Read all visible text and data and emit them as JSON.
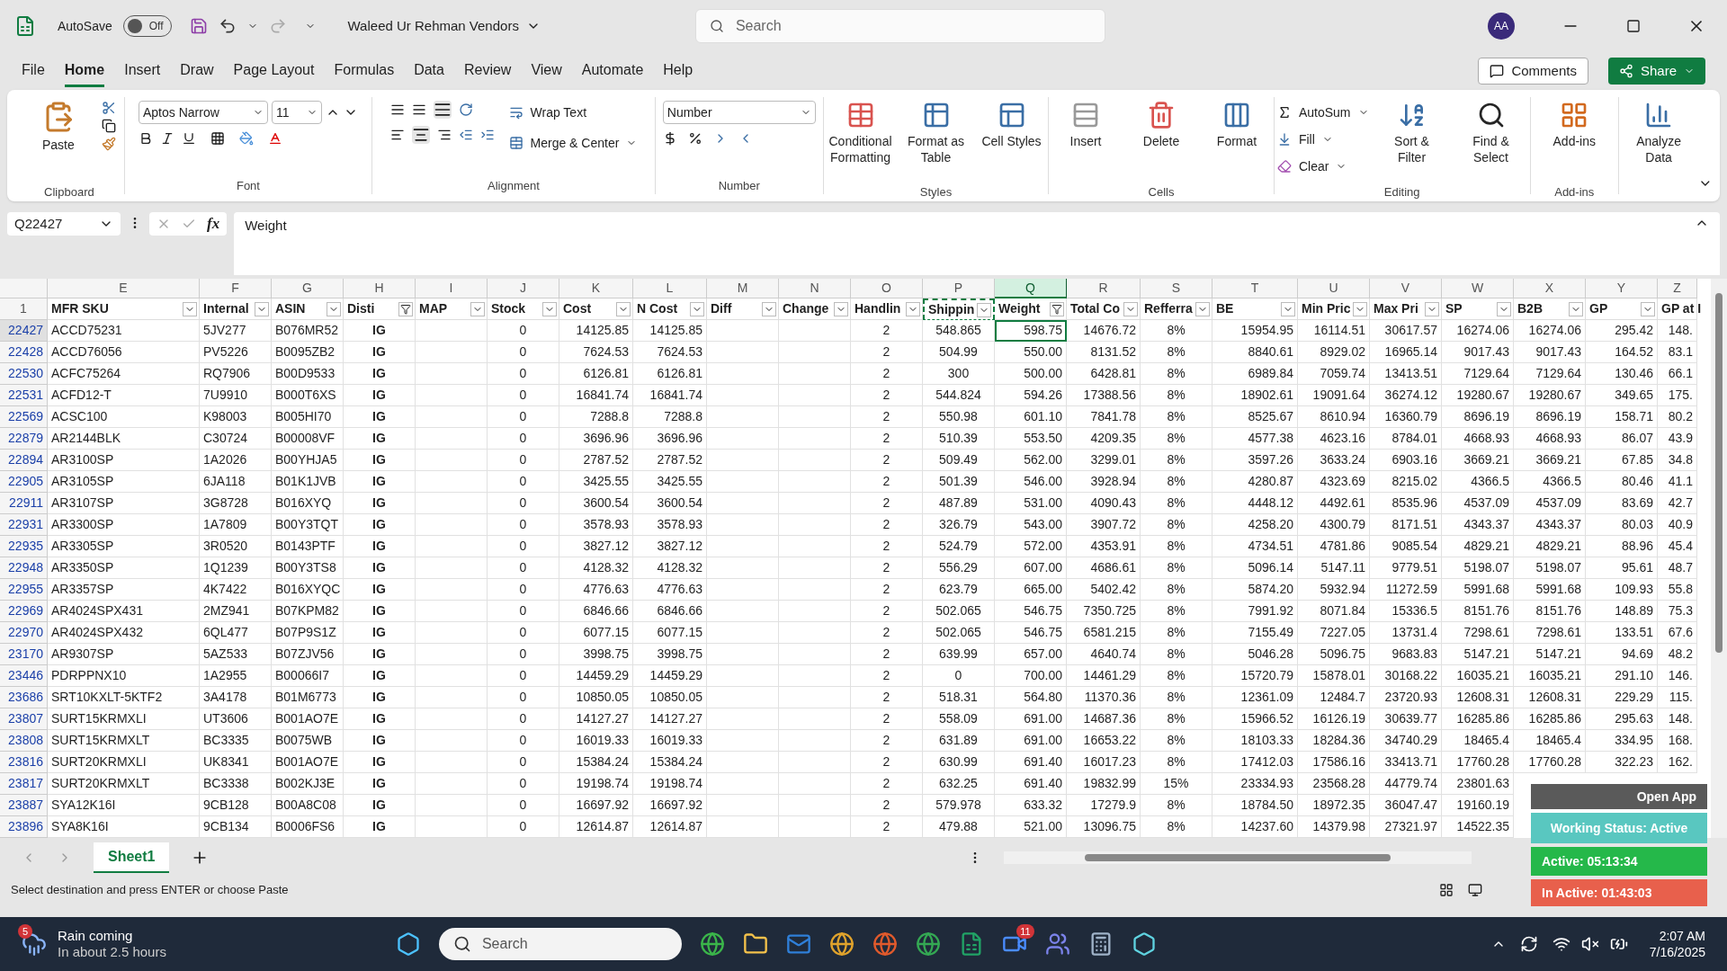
{
  "title_bar": {
    "autosave_label": "AutoSave",
    "autosave_state": "Off",
    "autosave_on": false,
    "document": "Waleed Ur Rehman Vendors",
    "search_placeholder": "Search",
    "avatar": "AA"
  },
  "menu_tabs": [
    {
      "label": "File",
      "selected": false
    },
    {
      "label": "Home",
      "selected": true
    },
    {
      "label": "Insert",
      "selected": false
    },
    {
      "label": "Draw",
      "selected": false
    },
    {
      "label": "Page Layout",
      "selected": false
    },
    {
      "label": "Formulas",
      "selected": false
    },
    {
      "label": "Data",
      "selected": false
    },
    {
      "label": "Review",
      "selected": false
    },
    {
      "label": "View",
      "selected": false
    },
    {
      "label": "Automate",
      "selected": false
    },
    {
      "label": "Help",
      "selected": false
    }
  ],
  "actions": {
    "comments": "Comments",
    "share": "Share"
  },
  "ribbon": {
    "paste": "Paste",
    "font_name": "Aptos Narrow",
    "font_size": "11",
    "wrap_text": "Wrap Text",
    "merge_center": "Merge & Center",
    "number_format": "Number",
    "styles": [
      "Conditional Formatting",
      "Format as Table",
      "Cell Styles"
    ],
    "cells": [
      "Insert",
      "Delete",
      "Format"
    ],
    "editing_small": [
      "AutoSum",
      "Fill",
      "Clear"
    ],
    "editing_large": [
      "Sort & Filter",
      "Find & Select"
    ],
    "addins": "Add-ins",
    "analyze": "Analyze Data",
    "group_labels": [
      "Clipboard",
      "Font",
      "Alignment",
      "Number",
      "Styles",
      "Cells",
      "Editing",
      "Add-ins"
    ]
  },
  "formula_bar": {
    "name_box": "Q22427",
    "function_label": "fx",
    "formula": "Weight"
  },
  "sheet": {
    "header_row_number": "1",
    "columns": [
      {
        "letter": "E",
        "header": "MFR SKU",
        "filtered": false,
        "selected": false,
        "copied": false
      },
      {
        "letter": "F",
        "header": "Internal",
        "filtered": false,
        "selected": false,
        "copied": false
      },
      {
        "letter": "G",
        "header": "ASIN",
        "filtered": false,
        "selected": false,
        "copied": false
      },
      {
        "letter": "H",
        "header": "Disti",
        "filtered": true,
        "selected": false,
        "copied": false
      },
      {
        "letter": "I",
        "header": "MAP",
        "filtered": false,
        "selected": false,
        "copied": false
      },
      {
        "letter": "J",
        "header": "Stock",
        "filtered": false,
        "selected": false,
        "copied": false
      },
      {
        "letter": "K",
        "header": "Cost",
        "filtered": false,
        "selected": false,
        "copied": false
      },
      {
        "letter": "L",
        "header": "N Cost",
        "filtered": false,
        "selected": false,
        "copied": false
      },
      {
        "letter": "M",
        "header": "Diff",
        "filtered": false,
        "selected": false,
        "copied": false
      },
      {
        "letter": "N",
        "header": "Change",
        "filtered": false,
        "selected": false,
        "copied": false
      },
      {
        "letter": "O",
        "header": "Handlin",
        "filtered": false,
        "selected": false,
        "copied": false
      },
      {
        "letter": "P",
        "header": "Shippin",
        "filtered": false,
        "selected": false,
        "copied": true
      },
      {
        "letter": "Q",
        "header": "Weight",
        "filtered": true,
        "selected": true,
        "copied": false
      },
      {
        "letter": "R",
        "header": "Total Co",
        "filtered": false,
        "selected": false,
        "copied": false
      },
      {
        "letter": "S",
        "header": "Refferra",
        "filtered": false,
        "selected": false,
        "copied": false
      },
      {
        "letter": "T",
        "header": "BE",
        "filtered": false,
        "selected": false,
        "copied": false
      },
      {
        "letter": "U",
        "header": "Min Pric",
        "filtered": false,
        "selected": false,
        "copied": false
      },
      {
        "letter": "V",
        "header": "Max Pri",
        "filtered": false,
        "selected": false,
        "copied": false
      },
      {
        "letter": "W",
        "header": "SP",
        "filtered": false,
        "selected": false,
        "copied": false
      },
      {
        "letter": "X",
        "header": "B2B",
        "filtered": false,
        "selected": false,
        "copied": false
      },
      {
        "letter": "Y",
        "header": "GP",
        "filtered": false,
        "selected": false,
        "copied": false
      },
      {
        "letter": "Z",
        "header": "GP at I",
        "selected": false,
        "copied": false
      }
    ],
    "rows": [
      {
        "row": "22427",
        "selected": true,
        "cells": [
          "ACCD75231",
          "5JV277",
          "B076MR52",
          "IG",
          null,
          "0",
          "14125.85",
          "14125.85",
          null,
          null,
          "2",
          "548.865",
          "598.75",
          "14676.72",
          "8%",
          "15954.95",
          "16114.51",
          "30617.57",
          "16274.06",
          "16274.06",
          "295.42",
          "148."
        ]
      },
      {
        "row": "22428",
        "selected": false,
        "cells": [
          "ACCD76056",
          "PV5226",
          "B0095ZB2",
          "IG",
          null,
          "0",
          "7624.53",
          "7624.53",
          null,
          null,
          "2",
          "504.99",
          "550.00",
          "8131.52",
          "8%",
          "8840.61",
          "8929.02",
          "16965.14",
          "9017.43",
          "9017.43",
          "164.52",
          "83.1"
        ]
      },
      {
        "row": "22530",
        "selected": false,
        "cells": [
          "ACFC75264",
          "RQ7906",
          "B00D9533",
          "IG",
          null,
          "0",
          "6126.81",
          "6126.81",
          null,
          null,
          "2",
          "300",
          "500.00",
          "6428.81",
          "8%",
          "6989.84",
          "7059.74",
          "13413.51",
          "7129.64",
          "7129.64",
          "130.46",
          "66.1"
        ]
      },
      {
        "row": "22531",
        "selected": false,
        "cells": [
          "ACFD12-T",
          "7U9910",
          "B000T6XS",
          "IG",
          null,
          "0",
          "16841.74",
          "16841.74",
          null,
          null,
          "2",
          "544.824",
          "594.26",
          "17388.56",
          "8%",
          "18902.61",
          "19091.64",
          "36274.12",
          "19280.67",
          "19280.67",
          "349.65",
          "175."
        ]
      },
      {
        "row": "22569",
        "selected": false,
        "cells": [
          "ACSC100",
          "K98003",
          "B005HI70",
          "IG",
          null,
          "0",
          "7288.8",
          "7288.8",
          null,
          null,
          "2",
          "550.98",
          "601.10",
          "7841.78",
          "8%",
          "8525.67",
          "8610.94",
          "16360.79",
          "8696.19",
          "8696.19",
          "158.71",
          "80.2"
        ]
      },
      {
        "row": "22879",
        "selected": false,
        "cells": [
          "AR2144BLK",
          "C30724",
          "B00008VF",
          "IG",
          null,
          "0",
          "3696.96",
          "3696.96",
          null,
          null,
          "2",
          "510.39",
          "553.50",
          "4209.35",
          "8%",
          "4577.38",
          "4623.16",
          "8784.01",
          "4668.93",
          "4668.93",
          "86.07",
          "43.9"
        ]
      },
      {
        "row": "22894",
        "selected": false,
        "cells": [
          "AR3100SP",
          "1A2026",
          "B00YHJA5",
          "IG",
          null,
          "0",
          "2787.52",
          "2787.52",
          null,
          null,
          "2",
          "509.49",
          "562.00",
          "3299.01",
          "8%",
          "3597.26",
          "3633.24",
          "6903.16",
          "3669.21",
          "3669.21",
          "67.85",
          "34.8"
        ]
      },
      {
        "row": "22905",
        "selected": false,
        "cells": [
          "AR3105SP",
          "6JA118",
          "B01K1JVB",
          "IG",
          null,
          "0",
          "3425.55",
          "3425.55",
          null,
          null,
          "2",
          "501.39",
          "546.00",
          "3928.94",
          "8%",
          "4280.87",
          "4323.69",
          "8215.02",
          "4366.5",
          "4366.5",
          "80.46",
          "41.1"
        ]
      },
      {
        "row": "22911",
        "selected": false,
        "cells": [
          "AR3107SP",
          "3G8728",
          "B016XYQ",
          "IG",
          null,
          "0",
          "3600.54",
          "3600.54",
          null,
          null,
          "2",
          "487.89",
          "531.00",
          "4090.43",
          "8%",
          "4448.12",
          "4492.61",
          "8535.96",
          "4537.09",
          "4537.09",
          "83.69",
          "42.7"
        ]
      },
      {
        "row": "22931",
        "selected": false,
        "cells": [
          "AR3300SP",
          "1A7809",
          "B00Y3TQT",
          "IG",
          null,
          "0",
          "3578.93",
          "3578.93",
          null,
          null,
          "2",
          "326.79",
          "543.00",
          "3907.72",
          "8%",
          "4258.20",
          "4300.79",
          "8171.51",
          "4343.37",
          "4343.37",
          "80.03",
          "40.9"
        ]
      },
      {
        "row": "22935",
        "selected": false,
        "cells": [
          "AR3305SP",
          "3R0520",
          "B0143PTF",
          "IG",
          null,
          "0",
          "3827.12",
          "3827.12",
          null,
          null,
          "2",
          "524.79",
          "572.00",
          "4353.91",
          "8%",
          "4734.51",
          "4781.86",
          "9085.54",
          "4829.21",
          "4829.21",
          "88.96",
          "45.4"
        ]
      },
      {
        "row": "22948",
        "selected": false,
        "cells": [
          "AR3350SP",
          "1Q1239",
          "B00Y3TS8",
          "IG",
          null,
          "0",
          "4128.32",
          "4128.32",
          null,
          null,
          "2",
          "556.29",
          "607.00",
          "4686.61",
          "8%",
          "5096.14",
          "5147.11",
          "9779.51",
          "5198.07",
          "5198.07",
          "95.61",
          "48.7"
        ]
      },
      {
        "row": "22955",
        "selected": false,
        "cells": [
          "AR3357SP",
          "4K7422",
          "B016XYQC",
          "IG",
          null,
          "0",
          "4776.63",
          "4776.63",
          null,
          null,
          "2",
          "623.79",
          "665.00",
          "5402.42",
          "8%",
          "5874.20",
          "5932.94",
          "11272.59",
          "5991.68",
          "5991.68",
          "109.93",
          "55.8"
        ]
      },
      {
        "row": "22969",
        "selected": false,
        "cells": [
          "AR4024SPX431",
          "2MZ941",
          "B07KPM82",
          "IG",
          null,
          "0",
          "6846.66",
          "6846.66",
          null,
          null,
          "2",
          "502.065",
          "546.75",
          "7350.725",
          "8%",
          "7991.92",
          "8071.84",
          "15336.5",
          "8151.76",
          "8151.76",
          "148.89",
          "75.3"
        ]
      },
      {
        "row": "22970",
        "selected": false,
        "cells": [
          "AR4024SPX432",
          "6QL477",
          "B07P9S1Z",
          "IG",
          null,
          "0",
          "6077.15",
          "6077.15",
          null,
          null,
          "2",
          "502.065",
          "546.75",
          "6581.215",
          "8%",
          "7155.49",
          "7227.05",
          "13731.4",
          "7298.61",
          "7298.61",
          "133.51",
          "67.6"
        ]
      },
      {
        "row": "23170",
        "selected": false,
        "cells": [
          "AR9307SP",
          "5AZ533",
          "B07ZJV56",
          "IG",
          null,
          "0",
          "3998.75",
          "3998.75",
          null,
          null,
          "2",
          "639.99",
          "657.00",
          "4640.74",
          "8%",
          "5046.28",
          "5096.75",
          "9683.83",
          "5147.21",
          "5147.21",
          "94.69",
          "48.2"
        ]
      },
      {
        "row": "23446",
        "selected": false,
        "cells": [
          "PDRPPNX10",
          "1A2955",
          "B00066I7",
          "IG",
          null,
          "0",
          "14459.29",
          "14459.29",
          null,
          null,
          "2",
          "0",
          "700.00",
          "14461.29",
          "8%",
          "15720.79",
          "15878.01",
          "30168.22",
          "16035.21",
          "16035.21",
          "291.10",
          "146."
        ]
      },
      {
        "row": "23686",
        "selected": false,
        "cells": [
          "SRT10KXLT-5KTF2",
          "3A4178",
          "B01M6773",
          "IG",
          null,
          "0",
          "10850.05",
          "10850.05",
          null,
          null,
          "2",
          "518.31",
          "564.80",
          "11370.36",
          "8%",
          "12361.09",
          "12484.7",
          "23720.93",
          "12608.31",
          "12608.31",
          "229.29",
          "115."
        ]
      },
      {
        "row": "23807",
        "selected": false,
        "cells": [
          "SURT15KRMXLI",
          "UT3606",
          "B001AO7E",
          "IG",
          null,
          "0",
          "14127.27",
          "14127.27",
          null,
          null,
          "2",
          "558.09",
          "691.00",
          "14687.36",
          "8%",
          "15966.52",
          "16126.19",
          "30639.77",
          "16285.86",
          "16285.86",
          "295.63",
          "148."
        ]
      },
      {
        "row": "23808",
        "selected": false,
        "cells": [
          "SURT15KRMXLT",
          "BC3335",
          "B0075WB",
          "IG",
          null,
          "0",
          "16019.33",
          "16019.33",
          null,
          null,
          "2",
          "631.89",
          "691.00",
          "16653.22",
          "8%",
          "18103.33",
          "18284.36",
          "34740.29",
          "18465.4",
          "18465.4",
          "334.95",
          "168."
        ]
      },
      {
        "row": "23816",
        "selected": false,
        "cells": [
          "SURT20KRMXLI",
          "UK8341",
          "B001AO7E",
          "IG",
          null,
          "0",
          "15384.24",
          "15384.24",
          null,
          null,
          "2",
          "630.99",
          "691.40",
          "16017.23",
          "8%",
          "17412.03",
          "17586.16",
          "33413.71",
          "17760.28",
          "17760.28",
          "322.23",
          "162."
        ]
      },
      {
        "row": "23817",
        "selected": false,
        "cells": [
          "SURT20KRMXLT",
          "BC3338",
          "B002KJ3E",
          "IG",
          null,
          "0",
          "19198.74",
          "19198.74",
          null,
          null,
          "2",
          "632.25",
          "691.40",
          "19832.99",
          "15%",
          "23334.93",
          "23568.28",
          "44779.74",
          "23801.63",
          null,
          null,
          null
        ]
      },
      {
        "row": "23887",
        "selected": false,
        "cells": [
          "SYA12K16I",
          "9CB128",
          "B00A8C08",
          "IG",
          null,
          "0",
          "16697.92",
          "16697.92",
          null,
          null,
          "2",
          "579.978",
          "633.32",
          "17279.9",
          "8%",
          "18784.50",
          "18972.35",
          "36047.47",
          "19160.19",
          null,
          null,
          null
        ]
      },
      {
        "row": "23896",
        "selected": false,
        "cells": [
          "SYA8K16I",
          "9CB134",
          "B0006FS6",
          "IG",
          null,
          "0",
          "12614.87",
          "12614.87",
          null,
          null,
          "2",
          "479.88",
          "521.00",
          "13096.75",
          "8%",
          "14237.60",
          "14379.98",
          "27321.97",
          "14522.35",
          null,
          null,
          null
        ]
      }
    ]
  },
  "sheet_tabs": [
    {
      "label": "Sheet1",
      "selected": true
    }
  ],
  "status_bar": {
    "message": "Select destination and press ENTER or choose Paste"
  },
  "tracker": {
    "open": "Open App",
    "status": "Working Status: Active",
    "active": "Active: 05:13:34",
    "inactive": "In Active: 01:43:03"
  },
  "taskbar": {
    "weather_badge": "5",
    "weather_title": "Rain coming",
    "weather_sub": "In about 2.5 hours",
    "search_placeholder": "Search",
    "zoom_badge": "11",
    "time": "2:07 AM",
    "date": "7/16/2025"
  }
}
